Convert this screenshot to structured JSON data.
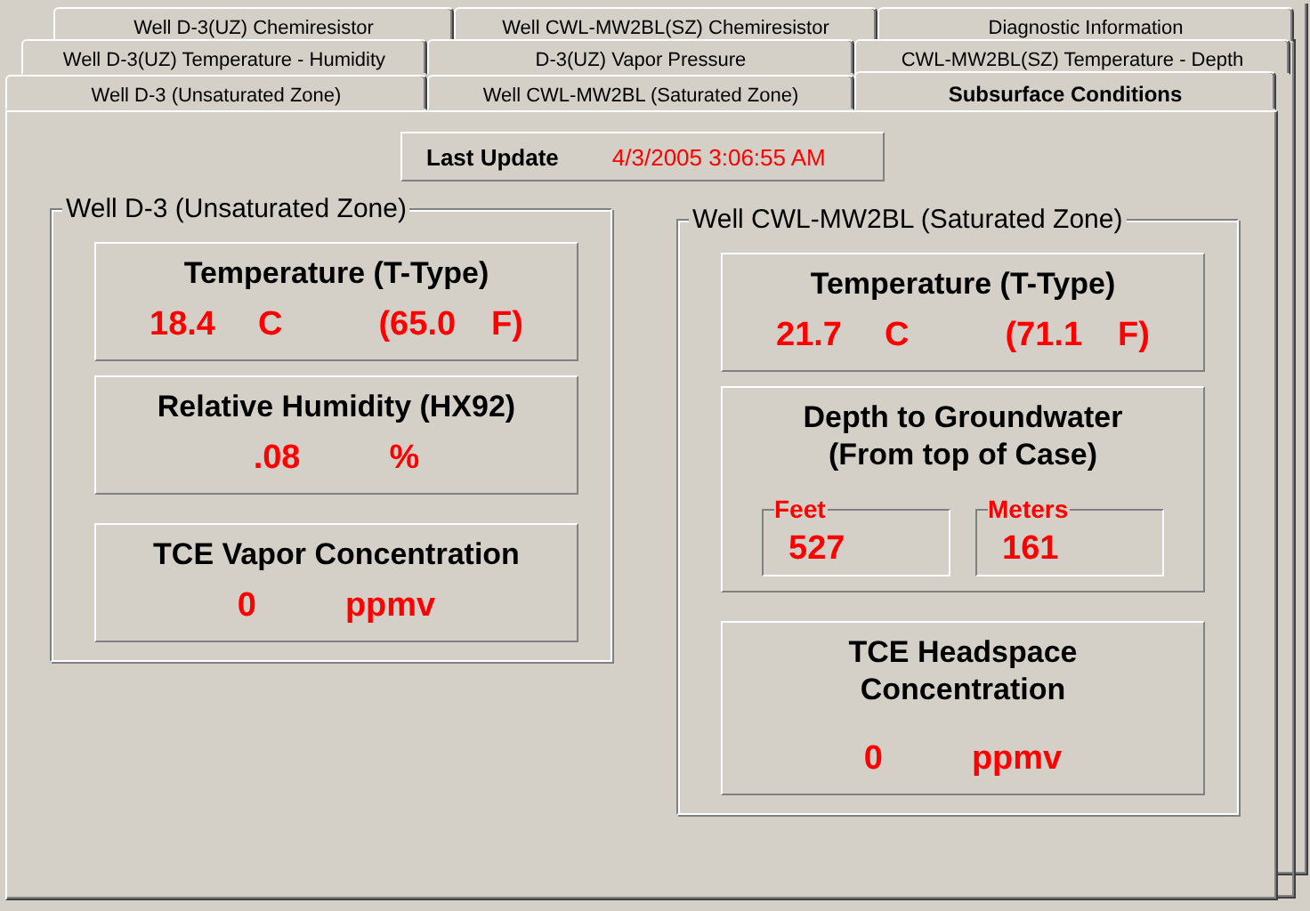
{
  "tab_rows": [
    [
      {
        "label": "Well D-3(UZ) Chemiresistor",
        "selected": false
      },
      {
        "label": "Well CWL-MW2BL(SZ) Chemiresistor",
        "selected": false
      },
      {
        "label": "Diagnostic Information",
        "selected": false
      }
    ],
    [
      {
        "label": "Well D-3(UZ) Temperature - Humidity",
        "selected": false
      },
      {
        "label": "D-3(UZ) Vapor Pressure",
        "selected": false
      },
      {
        "label": "CWL-MW2BL(SZ) Temperature - Depth",
        "selected": false
      }
    ],
    [
      {
        "label": "Well D-3 (Unsaturated Zone)",
        "selected": false
      },
      {
        "label": "Well CWL-MW2BL (Saturated Zone)",
        "selected": false
      },
      {
        "label": "Subsurface Conditions",
        "selected": true
      }
    ]
  ],
  "last_update": {
    "label": "Last Update",
    "value": "4/3/2005 3:06:55 AM"
  },
  "groups": [
    {
      "title": "Well D-3 (Unsaturated Zone)",
      "cards": [
        {
          "kind": "readings",
          "title_lines": [
            "Temperature (T-Type)"
          ],
          "values": [
            "18.4",
            "C",
            "(65.0",
            "F)"
          ]
        },
        {
          "kind": "readings",
          "title_lines": [
            "Relative Humidity (HX92)"
          ],
          "values": [
            ".08",
            "%"
          ]
        },
        {
          "kind": "readings",
          "title_lines": [
            "TCE Vapor Concentration"
          ],
          "values": [
            "0",
            "ppmv"
          ]
        }
      ]
    },
    {
      "title": "Well CWL-MW2BL (Saturated Zone)",
      "cards": [
        {
          "kind": "readings",
          "title_lines": [
            "Temperature (T-Type)"
          ],
          "values": [
            "21.7",
            "C",
            "(71.1",
            "F)"
          ]
        },
        {
          "kind": "fields",
          "title_lines": [
            "Depth to Groundwater",
            "(From top of Case)"
          ],
          "fields": [
            {
              "label": "Feet",
              "value": "527"
            },
            {
              "label": "Meters",
              "value": "161"
            }
          ]
        },
        {
          "kind": "readings",
          "title_lines": [
            "TCE Headspace",
            "Concentration"
          ],
          "values": [
            "0",
            "ppmv"
          ]
        }
      ]
    }
  ]
}
